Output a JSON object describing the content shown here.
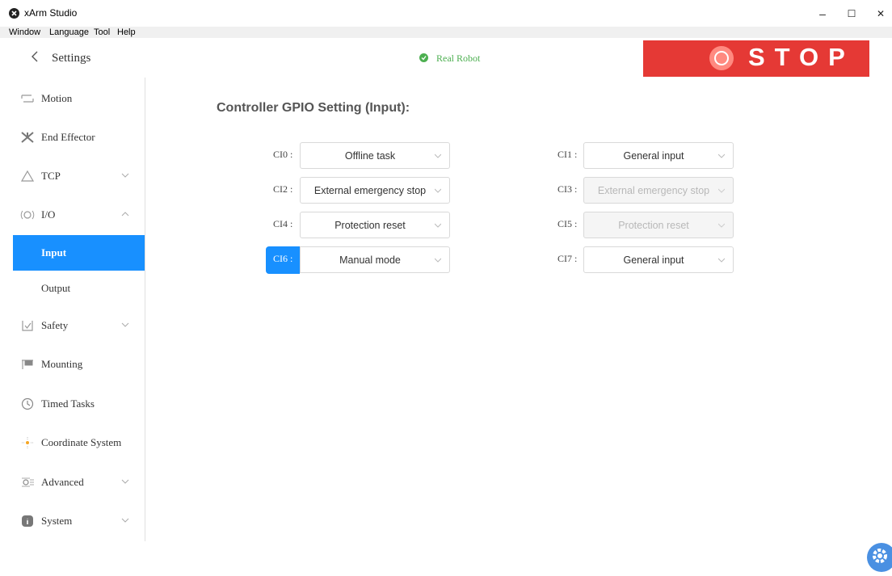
{
  "window": {
    "title": "xArm Studio",
    "minimize": "–",
    "maximize": "☐",
    "close": "✕"
  },
  "menu": [
    "Window",
    "Language",
    "Tool",
    "Help"
  ],
  "header": {
    "title": "Settings",
    "status": "Real Robot",
    "stop_label": "STOP"
  },
  "sidebar": {
    "items": [
      {
        "label": "Motion",
        "icon": "motion-icon",
        "has_chevron": false
      },
      {
        "label": "End Effector",
        "icon": "end-effector-icon",
        "has_chevron": false
      },
      {
        "label": "TCP",
        "icon": "tcp-icon",
        "has_chevron": true
      },
      {
        "label": "I/O",
        "icon": "io-icon",
        "has_chevron": true,
        "expanded": true
      },
      {
        "label": "Safety",
        "icon": "safety-icon",
        "has_chevron": true
      },
      {
        "label": "Mounting",
        "icon": "mounting-icon",
        "has_chevron": false
      },
      {
        "label": "Timed Tasks",
        "icon": "clock-icon",
        "has_chevron": false
      },
      {
        "label": "Coordinate System",
        "icon": "coordinate-icon",
        "has_chevron": false
      },
      {
        "label": "Advanced",
        "icon": "advanced-icon",
        "has_chevron": true
      },
      {
        "label": "System",
        "icon": "info-icon",
        "has_chevron": true
      }
    ],
    "io_sub": [
      {
        "label": "Input",
        "active": true
      },
      {
        "label": "Output",
        "active": false
      }
    ]
  },
  "main": {
    "title": "Controller GPIO Setting (Input):",
    "gpio": [
      {
        "label": "CI0 :",
        "value": "Offline task",
        "disabled": false,
        "active": false
      },
      {
        "label": "CI1 :",
        "value": "General input",
        "disabled": false,
        "active": false
      },
      {
        "label": "CI2 :",
        "value": "External emergency stop",
        "disabled": false,
        "active": false
      },
      {
        "label": "CI3 :",
        "value": "External emergency stop",
        "disabled": true,
        "active": false
      },
      {
        "label": "CI4 :",
        "value": "Protection reset",
        "disabled": false,
        "active": false
      },
      {
        "label": "CI5 :",
        "value": "Protection reset",
        "disabled": true,
        "active": false
      },
      {
        "label": "CI6 :",
        "value": "Manual mode",
        "disabled": false,
        "active": true
      },
      {
        "label": "CI7 :",
        "value": "General input",
        "disabled": false,
        "active": false
      }
    ]
  },
  "colors": {
    "accent": "#1890ff",
    "stop": "#e53935",
    "status": "#4caf50"
  }
}
